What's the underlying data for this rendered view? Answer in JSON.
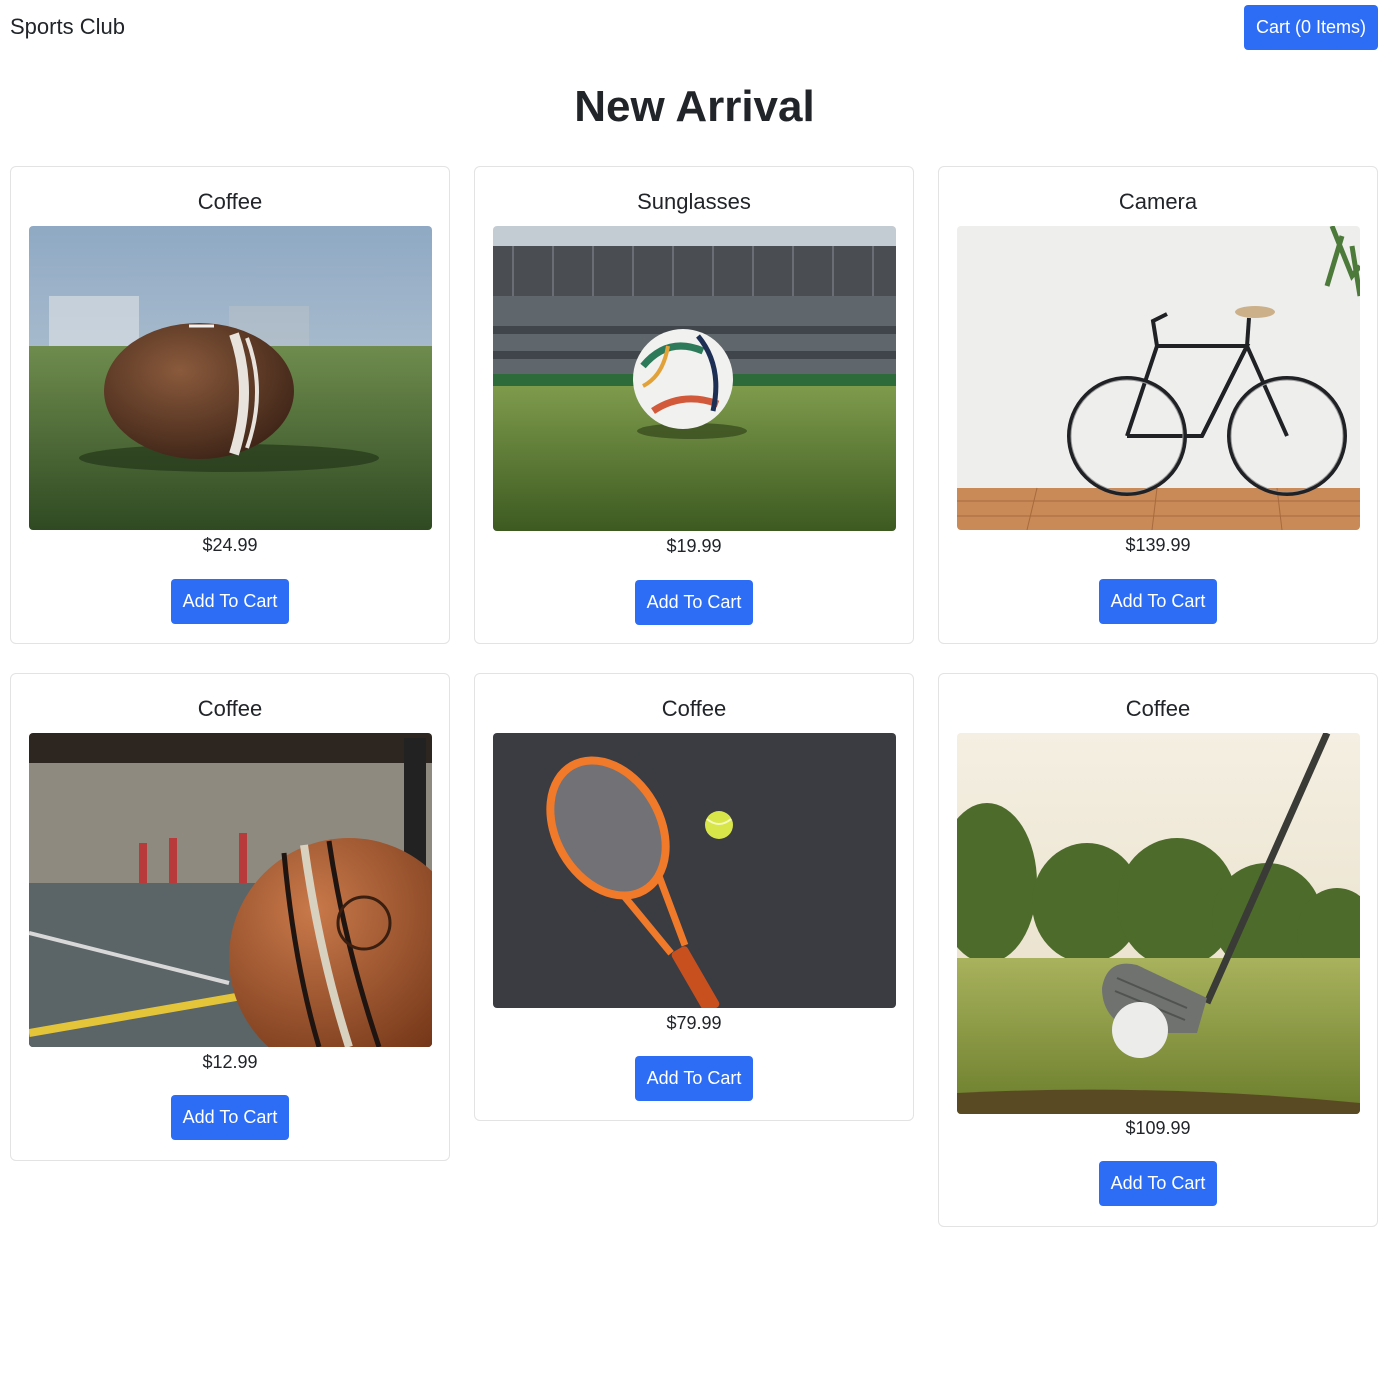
{
  "header": {
    "brand": "Sports Club",
    "cart_label": "Cart (0 Items)"
  },
  "main": {
    "title": "New Arrival",
    "products": [
      {
        "name": "Coffee",
        "price": "$24.99",
        "button": "Add To Cart",
        "image": "american-football-on-turf"
      },
      {
        "name": "Sunglasses",
        "price": "$19.99",
        "button": "Add To Cart",
        "image": "soccer-ball-in-stadium"
      },
      {
        "name": "Camera",
        "price": "$139.99",
        "button": "Add To Cart",
        "image": "bicycle-against-white-wall"
      },
      {
        "name": "Coffee",
        "price": "$12.99",
        "button": "Add To Cart",
        "image": "basketball-on-indoor-court"
      },
      {
        "name": "Coffee",
        "price": "$79.99",
        "button": "Add To Cart",
        "image": "tennis-racket-and-ball"
      },
      {
        "name": "Coffee",
        "price": "$109.99",
        "button": "Add To Cart",
        "image": "golf-club-and-ball"
      }
    ]
  },
  "colors": {
    "accent": "#2d6df6",
    "card_border": "#e3e3e3",
    "text": "#212529"
  }
}
